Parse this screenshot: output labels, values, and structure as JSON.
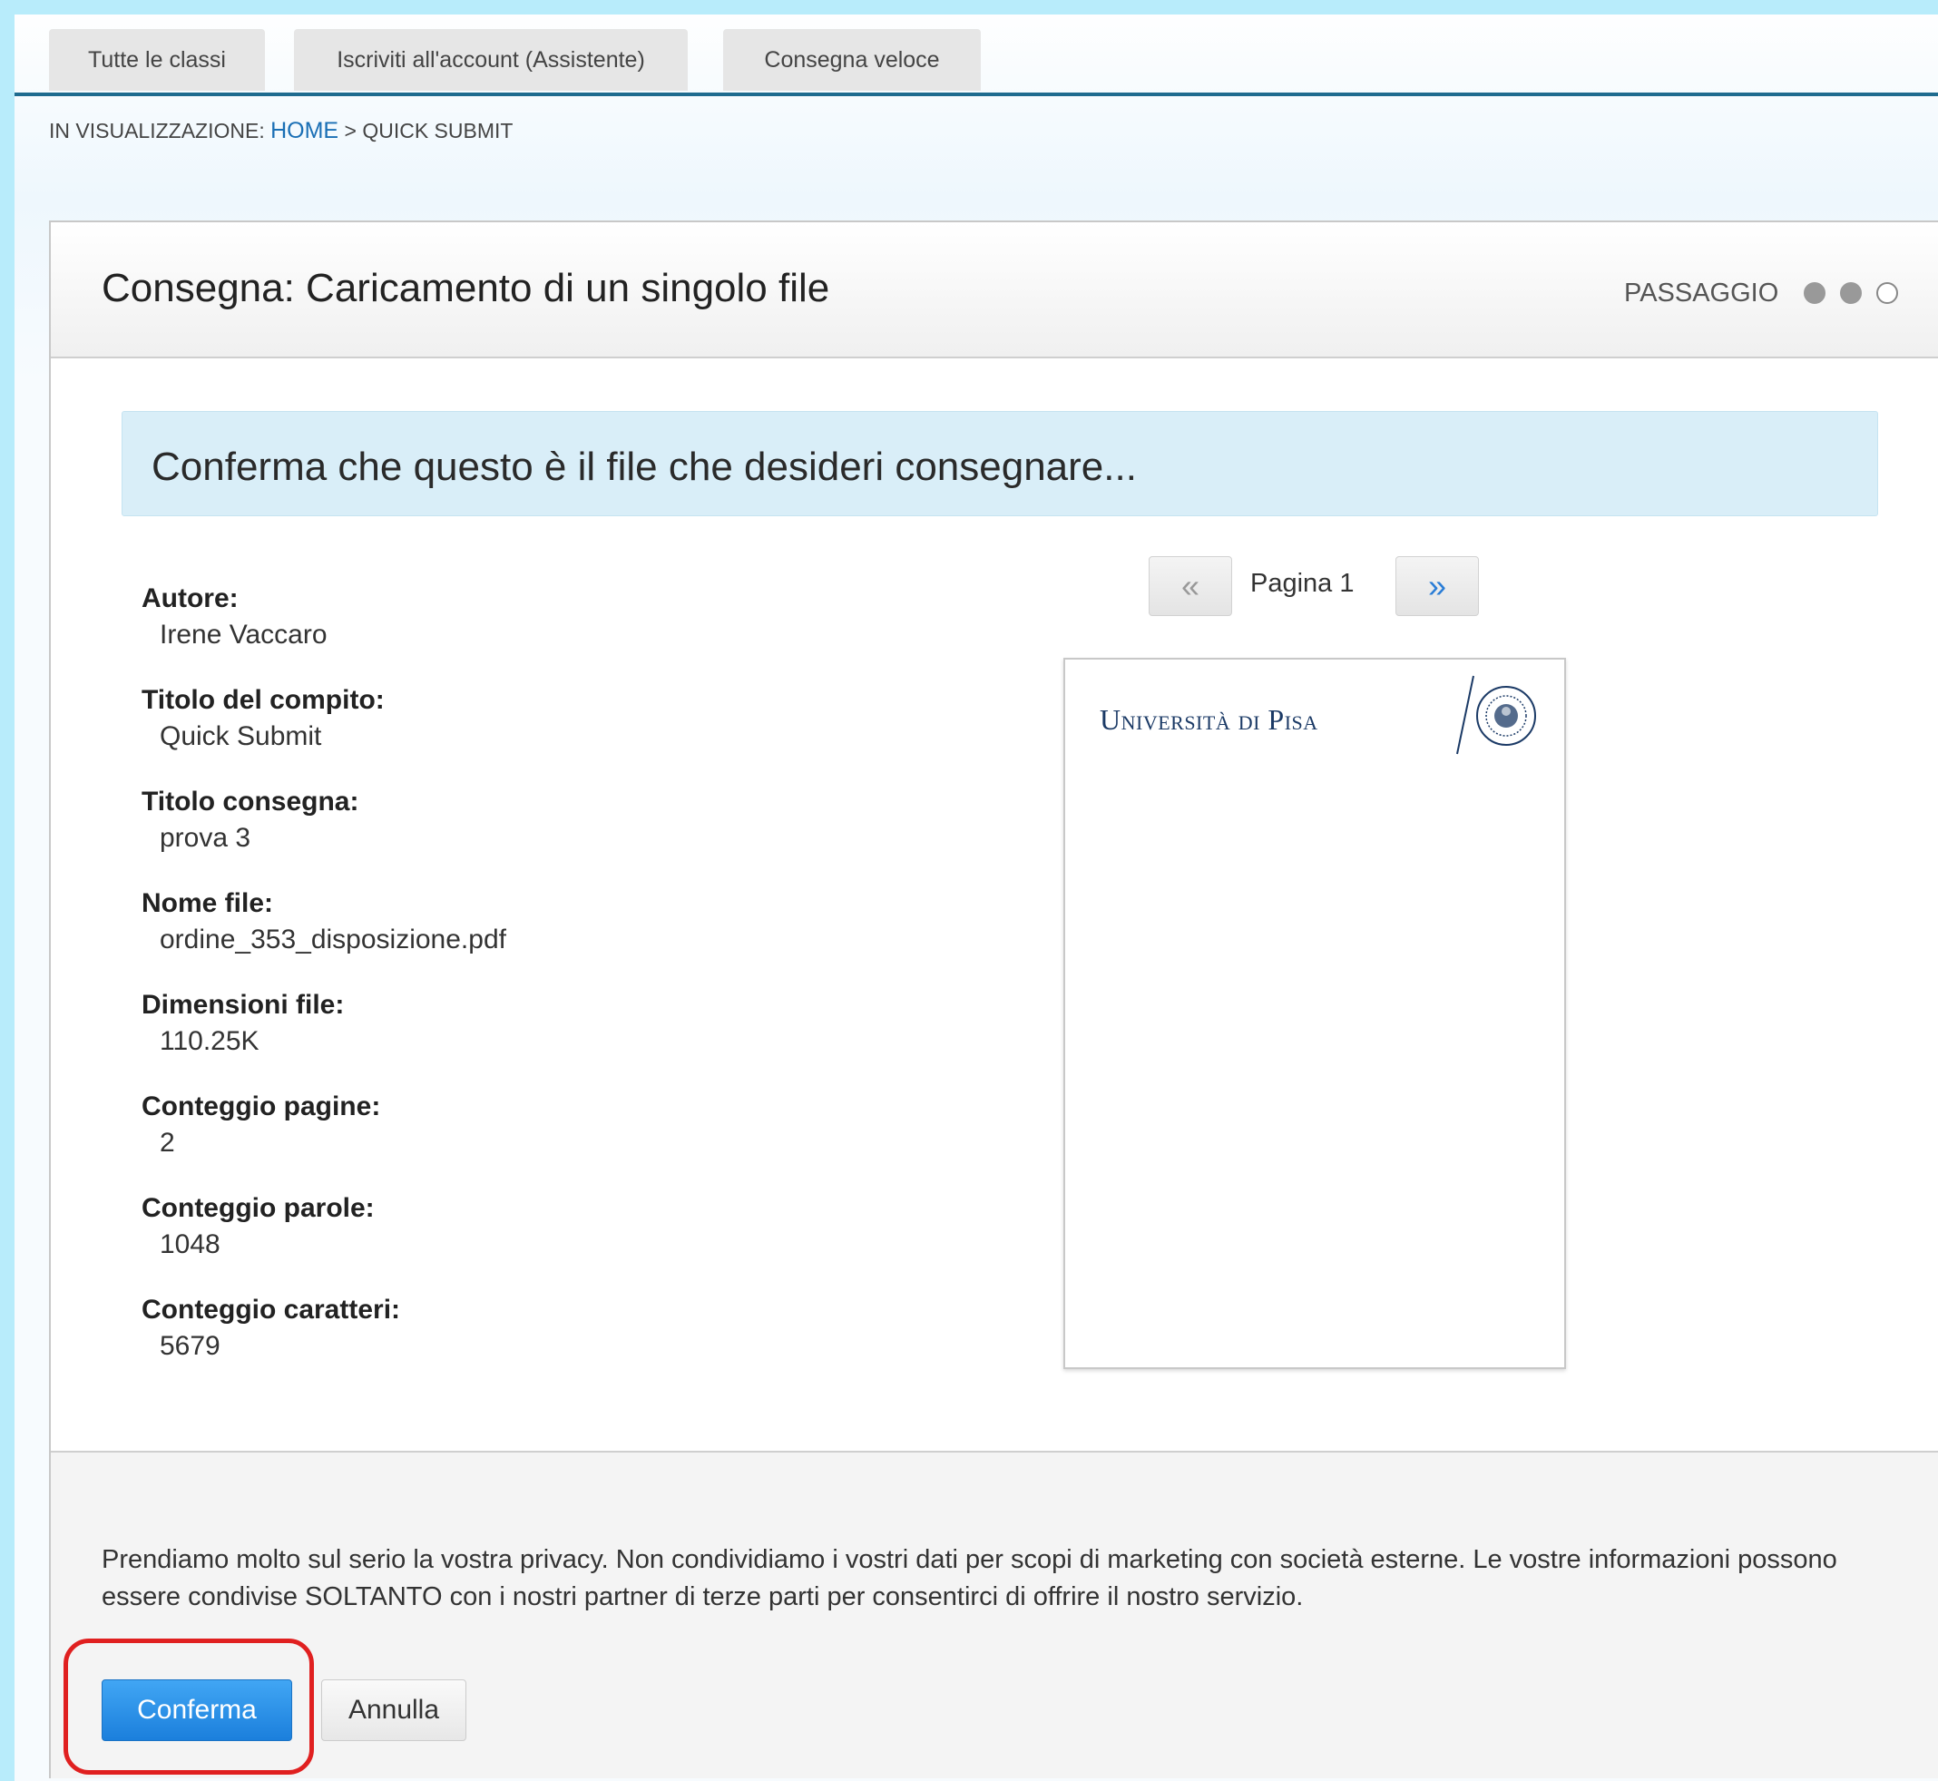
{
  "tabs": [
    {
      "label": "Tutte le classi"
    },
    {
      "label": "Iscriviti all'account (Assistente)"
    },
    {
      "label": "Consegna veloce"
    }
  ],
  "breadcrumb": {
    "prefix": "IN VISUALIZZAZIONE:",
    "home": "HOME",
    "separator": ">",
    "current": "QUICK SUBMIT"
  },
  "panel": {
    "title": "Consegna: Caricamento di un singolo file",
    "step_label": "PASSAGGIO",
    "steps_total": 3,
    "steps_completed": 2
  },
  "banner": {
    "text": "Conferma che questo è il file che desideri consegnare..."
  },
  "metadata": [
    {
      "label": "Autore:",
      "value": "Irene Vaccaro"
    },
    {
      "label": "Titolo del compito:",
      "value": "Quick Submit"
    },
    {
      "label": "Titolo consegna:",
      "value": "prova 3"
    },
    {
      "label": "Nome file:",
      "value": "ordine_353_disposizione.pdf"
    },
    {
      "label": "Dimensioni file:",
      "value": "110.25K"
    },
    {
      "label": "Conteggio pagine:",
      "value": "2"
    },
    {
      "label": "Conteggio parole:",
      "value": "1048"
    },
    {
      "label": "Conteggio caratteri:",
      "value": "5679"
    }
  ],
  "pager": {
    "prev": "«",
    "next": "»",
    "label": "Pagina 1"
  },
  "preview": {
    "logo_text": "Università di Pisa"
  },
  "footer": {
    "privacy": "Prendiamo molto sul serio la vostra privacy. Non condividiamo i vostri dati per scopi di marketing con società esterne. Le vostre informazioni possono essere condivise SOLTANTO con i nostri partner di terze parti per consentirci di offrire il nostro servizio.",
    "confirm_label": "Conferma",
    "cancel_label": "Annulla"
  },
  "colors": {
    "accent": "#1b7fdc",
    "highlight": "#e02020",
    "page_background": "#b8ecfb"
  }
}
